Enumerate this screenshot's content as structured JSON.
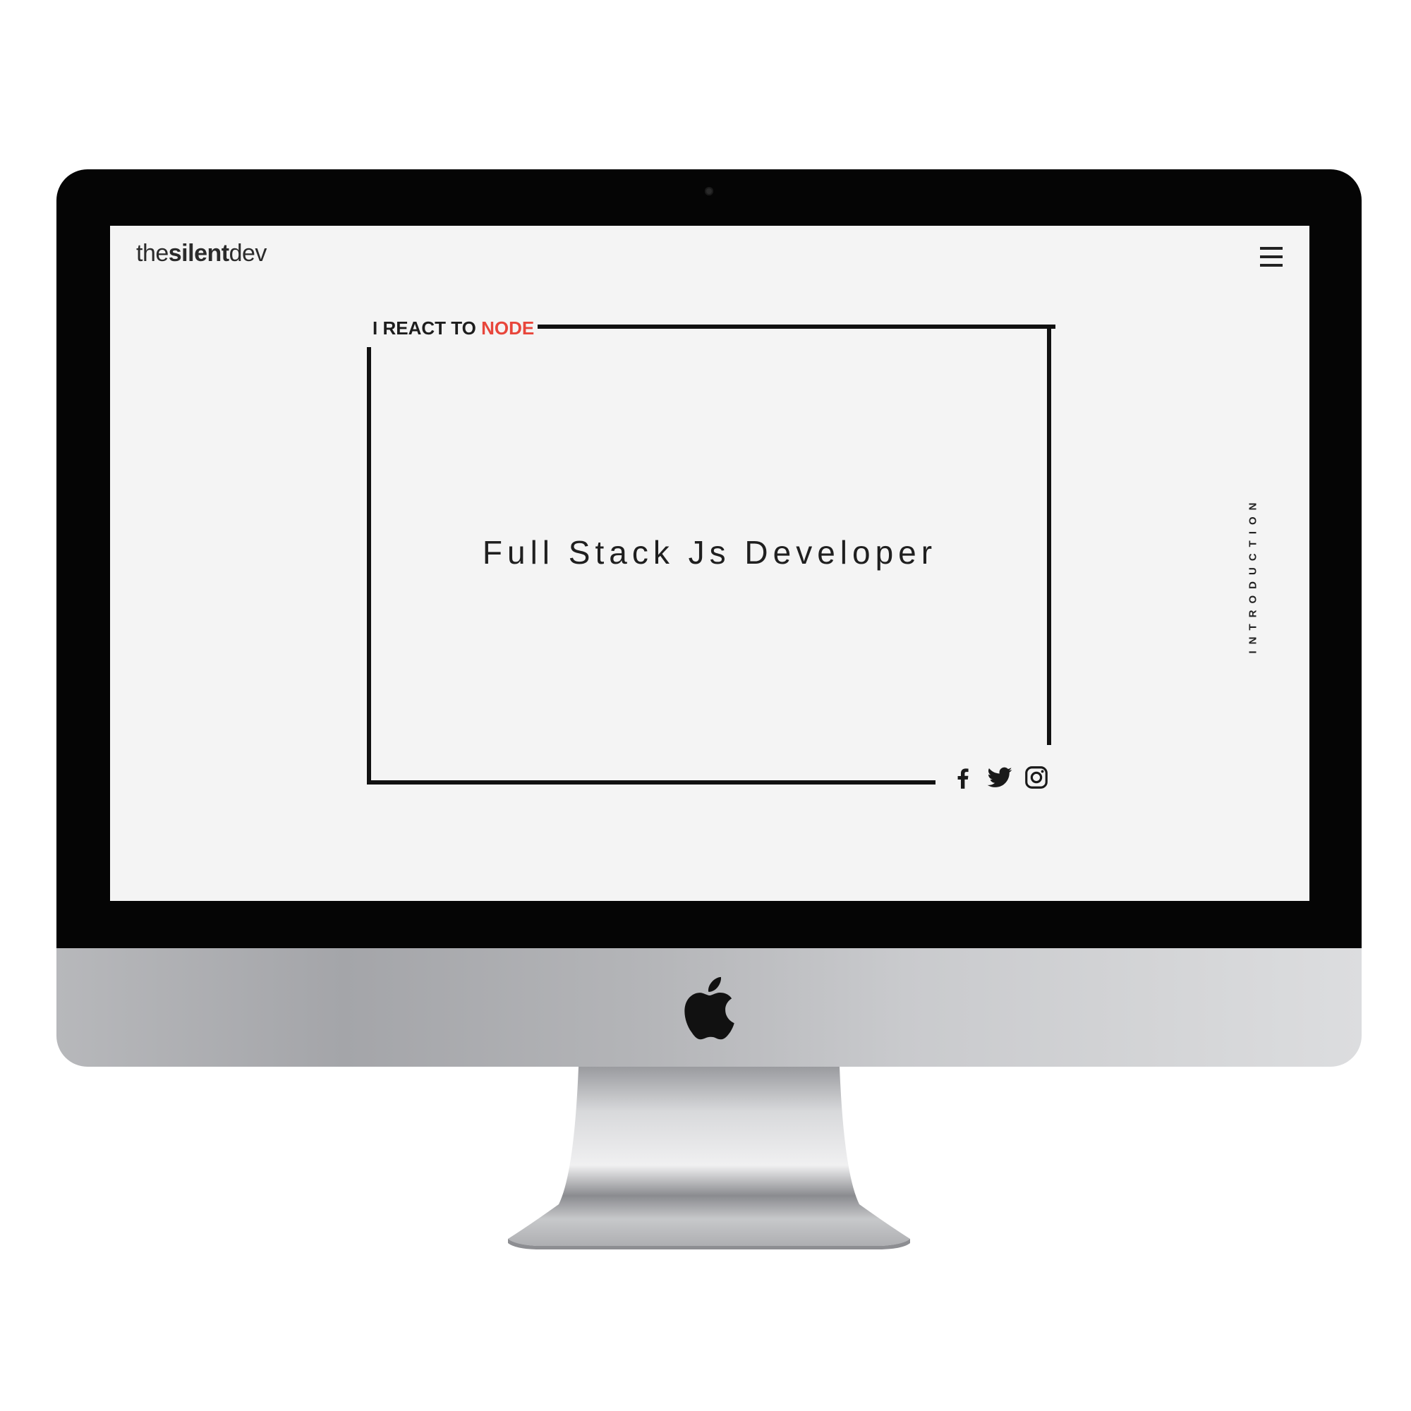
{
  "site": {
    "brand_prefix": "the",
    "brand_bold": "silent",
    "brand_suffix": "dev"
  },
  "hero": {
    "tagline_prefix": "I REACT TO ",
    "tagline_accent": "NODE",
    "headline": "Full Stack Js Developer",
    "section_label": "INTRODUCTION"
  },
  "social": [
    "facebook-icon",
    "twitter-icon",
    "instagram-icon"
  ],
  "icons": {
    "menu": "hamburger-menu-icon"
  },
  "colors": {
    "screen_background": "#f4f4f4",
    "accent": "#e8463b",
    "text": "#1f1f1f",
    "bezel": "#050505"
  }
}
